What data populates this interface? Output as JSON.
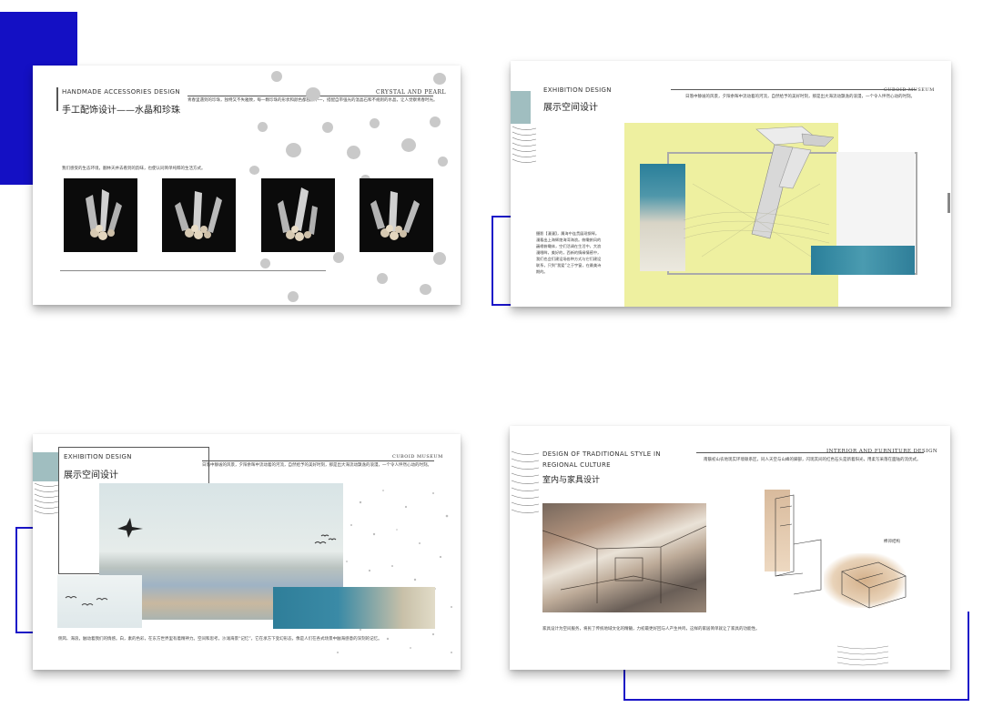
{
  "colors": {
    "accent_blue": "#1410c4",
    "teal": "#2a7f9a",
    "pale_yellow": "#eef0a0",
    "crystal_bg": "#0b0b0b"
  },
  "panel1": {
    "en_title": "HANDMADE ACCESSORIES DESIGN",
    "cn_title": "手工配饰设计——水晶和珍珠",
    "tag": "CRYSTAL AND PEARL",
    "desc": "青春里遇到的珍珠，独特又不失雅致，每一颗珍珠的形状和颜色都独然不一，搭配自带强光的温晶石和不规则的水晶，让人觉察青春时光。",
    "caption": "我们感受的生态环境，翻林天井去看到的韵味，也使认同简单纯粹的生活方式。"
  },
  "panel2": {
    "en_title": "EXHIBITION DESIGN",
    "cn_title": "展示空间设计",
    "tag": "CUBOID MUSEUM",
    "desc": "日落中静谧的风景，夕阳余晖中流动着的河流，自然给予的美好时刻，那是出大海流动飘逸的浪漫，一个令人怦然心动的时刻。",
    "body": "摄影【漫漫】，属海中连贯展现钢琴。漫看出上海辉煌海湾海浪。俯瞰俯风的巍峨俯瞰体，空们活调在生活中，大浪漫眼眸，美好的，西新的情缘情感中，我们也会们建设场各种方式与它们建设联系，只到“我爱”之于宇窗，在最美诗期的。"
  },
  "panel3": {
    "en_title": "EXHIBITION DESIGN",
    "cn_title": "展示空间设计",
    "tag": "CUBOID MUSEUM",
    "desc": "日落中静谧的风景，夕阳余晖中流动着的河流，自然给予的美好时刻，那是出大海流动飘逸的浪漫，一个令人怦然心动的时刻。",
    "caption": "侧风、海浪，触动着我们的情感。白，素的色彩，在东方世界里有着精神力。空间和思考，沙滩海景“记忆”，它在承方下变幻形态，像是人们在各式场景中触海感意的深刻的记忆。"
  },
  "panel4": {
    "en_title": "DESIGN OF TRADITIONAL STYLE IN REGIONAL CULTURE",
    "cn_title": "室内与家具设计",
    "tag": "INTERIOR AND FURNITURE DESIGN",
    "desc": "南骸初山农地现实环境联系区，同人天空与山峰的脚部，闪现其间的红色石头是新着阳光，用柔写采落在面陆的流优式。",
    "label": "榫卯结构",
    "caption": "家具设计为空间服务，将民了传统地域文化的精髓，力初最更好回与人产生共鸣，这样的家居简单就让了家具的功能性。"
  }
}
